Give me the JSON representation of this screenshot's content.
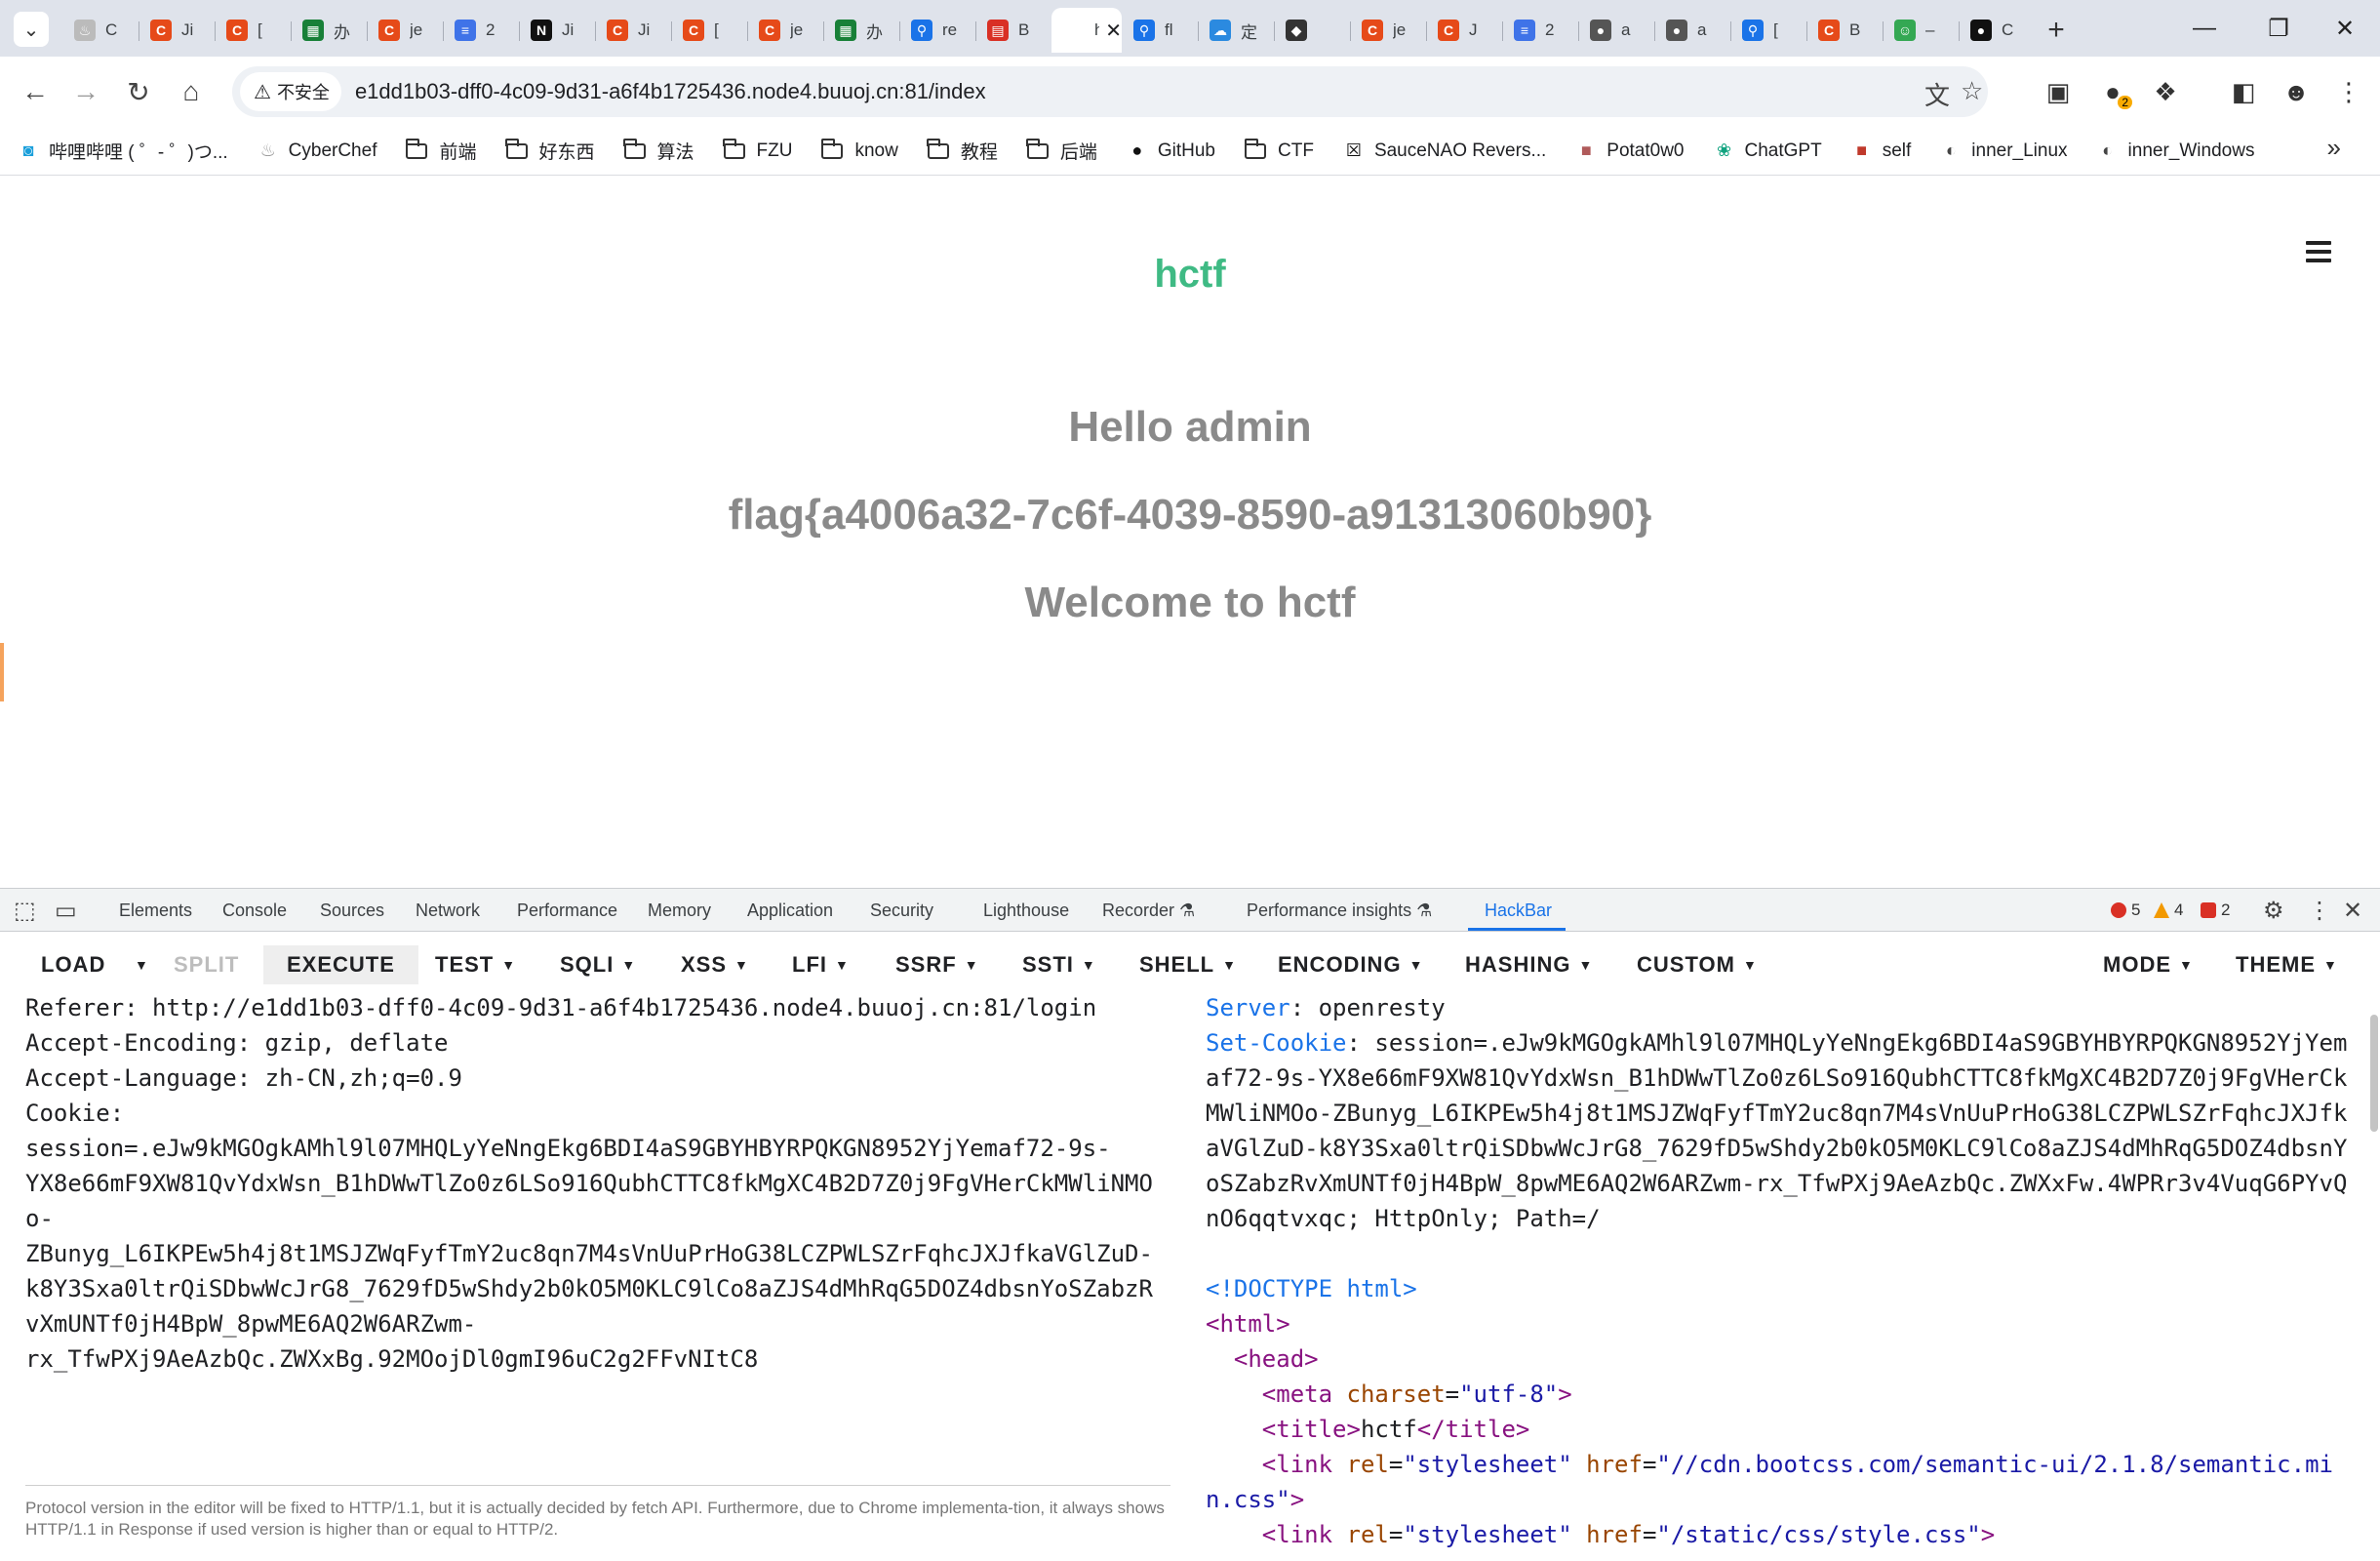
{
  "browser": {
    "tabs": [
      {
        "icon": "chef-icon",
        "title": "C",
        "color": "#bbbbbb",
        "glyph": "♨"
      },
      {
        "icon": "csdn-icon",
        "title": "Ji",
        "color": "#e64a19",
        "glyph": "C"
      },
      {
        "icon": "csdn-icon",
        "title": "[",
        "color": "#e64a19",
        "glyph": "C"
      },
      {
        "icon": "sheets-icon",
        "title": "办",
        "color": "#188038",
        "glyph": "▦"
      },
      {
        "icon": "csdn-icon",
        "title": "je",
        "color": "#e64a19",
        "glyph": "C"
      },
      {
        "icon": "docs-icon",
        "title": "2",
        "color": "#3f73e8",
        "glyph": "≡"
      },
      {
        "icon": "notion-icon",
        "title": "Ji",
        "color": "#111111",
        "glyph": "N"
      },
      {
        "icon": "csdn-icon",
        "title": "Ji",
        "color": "#e64a19",
        "glyph": "C"
      },
      {
        "icon": "csdn-icon",
        "title": "[",
        "color": "#e64a19",
        "glyph": "C"
      },
      {
        "icon": "csdn-icon",
        "title": "je",
        "color": "#e64a19",
        "glyph": "C"
      },
      {
        "icon": "sheets-icon",
        "title": "办",
        "color": "#188038",
        "glyph": "▦"
      },
      {
        "icon": "search-icon",
        "title": "re",
        "color": "#1a73e8",
        "glyph": "⚲"
      },
      {
        "icon": "pdf-icon",
        "title": "B",
        "color": "#d93025",
        "glyph": "▤"
      },
      {
        "icon": "page-icon",
        "title": "h",
        "color": "#ffffff",
        "glyph": "",
        "active": true,
        "close": "✕"
      },
      {
        "icon": "search-icon",
        "title": "fl",
        "color": "#1a73e8",
        "glyph": "⚲"
      },
      {
        "icon": "cloud-icon",
        "title": "定",
        "color": "#2b8ae0",
        "glyph": "☁"
      },
      {
        "icon": "cat-icon",
        "title": "",
        "color": "#333333",
        "glyph": "◆"
      },
      {
        "icon": "csdn-icon",
        "title": "je",
        "color": "#e64a19",
        "glyph": "C"
      },
      {
        "icon": "csdn-icon",
        "title": "J",
        "color": "#e64a19",
        "glyph": "C"
      },
      {
        "icon": "docs-icon",
        "title": "2",
        "color": "#3f73e8",
        "glyph": "≡"
      },
      {
        "icon": "globe-icon",
        "title": "a",
        "color": "#555555",
        "glyph": "●"
      },
      {
        "icon": "globe-icon",
        "title": "a",
        "color": "#555555",
        "glyph": "●"
      },
      {
        "icon": "search-icon",
        "title": "[",
        "color": "#1a73e8",
        "glyph": "⚲"
      },
      {
        "icon": "csdn-icon",
        "title": "B",
        "color": "#e64a19",
        "glyph": "C"
      },
      {
        "icon": "chat-icon",
        "title": "–",
        "color": "#34a853",
        "glyph": "☺"
      },
      {
        "icon": "github-icon",
        "title": "C",
        "color": "#111111",
        "glyph": "●"
      }
    ],
    "new_tab": "+",
    "menu_glyph": "⌄",
    "window_controls": {
      "minimize": "—",
      "restore": "❐",
      "close": "✕"
    },
    "nav": {
      "back": "←",
      "forward": "→",
      "reload": "↻",
      "home": "⌂"
    },
    "security_label": "不安全",
    "security_glyph": "⚠",
    "url": "e1dd1b03-dff0-4c09-9d31-a6f4b1725436.node4.buuoj.cn:81/index",
    "omnibox_icons": {
      "translate": "文",
      "star": "☆"
    },
    "toolbar_icons": {
      "extension_1": "▣",
      "extension_2": "●",
      "extension_badge": "2",
      "extensions": "❖",
      "sidepanel": "◧",
      "profile": "☻",
      "menu": "⋮"
    },
    "bookmarks": [
      {
        "label": "哔哩哔哩 ( ゜- ゜)つ...",
        "icon": "bilibili-icon",
        "glyph": "◙",
        "color": "#1a9fdb"
      },
      {
        "label": "CyberChef",
        "icon": "chef-icon",
        "glyph": "♨",
        "color": "#999999"
      },
      {
        "label": "前端",
        "icon": "folder-icon",
        "folder": true
      },
      {
        "label": "好东西",
        "icon": "folder-icon",
        "folder": true
      },
      {
        "label": "算法",
        "icon": "folder-icon",
        "folder": true
      },
      {
        "label": "FZU",
        "icon": "folder-icon",
        "folder": true
      },
      {
        "label": "know",
        "icon": "folder-icon",
        "folder": true
      },
      {
        "label": "教程",
        "icon": "folder-icon",
        "folder": true
      },
      {
        "label": "后端",
        "icon": "folder-icon",
        "folder": true
      },
      {
        "label": "GitHub",
        "icon": "github-icon",
        "glyph": "●",
        "color": "#111111"
      },
      {
        "label": "CTF",
        "icon": "folder-icon",
        "folder": true
      },
      {
        "label": "SauceNAO Revers...",
        "icon": "saucenao-icon",
        "glyph": "☒",
        "color": "#111111"
      },
      {
        "label": "Potat0w0",
        "icon": "avatar-icon",
        "glyph": "■",
        "color": "#b05a5a"
      },
      {
        "label": "ChatGPT",
        "icon": "chatgpt-icon",
        "glyph": "❀",
        "color": "#10a37f"
      },
      {
        "label": "self",
        "icon": "avatar-icon",
        "glyph": "■",
        "color": "#c0392b"
      },
      {
        "label": "inner_Linux",
        "icon": "globe-icon",
        "glyph": "◐",
        "color": "#444444"
      },
      {
        "label": "inner_Windows",
        "icon": "globe-icon",
        "glyph": "◐",
        "color": "#444444"
      }
    ],
    "bookmarks_more": "»"
  },
  "page": {
    "site_title": "hctf",
    "greeting": "Hello admin",
    "flag": "flag{a4006a32-7c6f-4039-8590-a91313060b90}",
    "welcome": "Welcome to hctf",
    "accent": "#3fba84"
  },
  "devtools": {
    "tabs": [
      "Elements",
      "Console",
      "Sources",
      "Network",
      "Performance",
      "Memory",
      "Application",
      "Security",
      "Lighthouse",
      "Recorder ⚗",
      "Performance insights ⚗",
      "HackBar"
    ],
    "active_tab": "HackBar",
    "errors": "5",
    "warnings": "4",
    "issues": "2",
    "icons": {
      "inspect": "⬚",
      "device": "▭",
      "settings": "⚙",
      "more": "⋮",
      "close": "✕"
    },
    "hackbar": {
      "load": "LOAD",
      "split": "SPLIT",
      "execute": "EXECUTE",
      "menus": [
        "TEST",
        "SQLI",
        "XSS",
        "LFI",
        "SSRF",
        "SSTI",
        "SHELL",
        "ENCODING",
        "HASHING",
        "CUSTOM"
      ],
      "mode": "MODE",
      "theme": "THEME",
      "caret": "▼",
      "request_lines": [
        "Referer: http://e1dd1b03-dff0-4c09-9d31-a6f4b1725436.node4.buuoj.cn:81/login",
        "Accept-Encoding: gzip, deflate",
        "Accept-Language: zh-CN,zh;q=0.9",
        "Cookie:",
        "session=.eJw9kMGOgkAMhl9l07MHQLyYeNngEkg6BDI4aS9GBYHBYRPQKGN8952YjYemaf72-9s-",
        "YX8e66mF9XW81QvYdxWsn_B1hDWwTlZo0z6LSo916QubhCTTC8fkMgXC4B2D7Z0j9FgVHerCkMWliNMO",
        "o-",
        "ZBunyg_L6IKPEw5h4j8t1MSJZWqFyfTmY2uc8qn7M4sVnUuPrHoG38LCZPWLSZrFqhcJXJfkaVGlZuD-",
        "k8Y3Sxa0ltrQiSDbwWcJrG8_7629fD5wShdy2b0kO5M0KLC9lCo8aZJS4dMhRqG5DOZ4dbsnYoSZabzR",
        "vXmUNTf0jH4BpW_8pwME6AQ2W6ARZwm-",
        "rx_TfwPXj9AeAzbQc.ZWXxBg.92MOojDl0gmI96uC2g2FFvNItC8"
      ],
      "note": "Protocol version in the editor will be fixed to HTTP/1.1, but it is actually decided by fetch API. Furthermore, due to Chrome implementa-tion, it always shows HTTP/1.1 in Response if used version is higher than or equal to HTTP/2.",
      "response": {
        "server_key": "Server",
        "server_val": ": openresty",
        "cookie_key": "Set-Cookie",
        "cookie_val": ": session=.eJw9kMGOgkAMhl9l07MHQLyYeNngEkg6BDI4aS9GBYHBYRPQKGN8952YjYemaf72-9s-YX8e66mF9XW81QvYdxWsn_B1hDWwTlZo0z6LSo916QubhCTTC8fkMgXC4B2D7Z0j9FgVHerCkMWliNMOo-ZBunyg_L6IKPEw5h4j8t1MSJZWqFyfTmY2uc8qn7M4sVnUuPrHoG38LCZPWLSZrFqhcJXJfkaVGlZuD-k8Y3Sxa0ltrQiSDbwWcJrG8_7629fD5wShdy2b0kO5M0KLC9lCo8aZJS4dMhRqG5DOZ4dbsnYoSZabzRvXmUNTf0jH4BpW_8pwME6AQ2W6ARZwm-rx_TfwPXj9AeAzbQc.ZWXxFw.4WPRr3v4VuqG6PYvQnO6qqtvxqc; HttpOnly; Path=/",
        "doctype": "<!DOCTYPE html>",
        "html_open": "<html>",
        "head_open": "<head>",
        "meta": {
          "tag": "meta",
          "attr": "charset",
          "val": "\"utf-8\""
        },
        "title": {
          "open": "<title>",
          "text": "hctf",
          "close": "</title>"
        },
        "link1": {
          "tag": "link",
          "attr1": "rel",
          "val1": "\"stylesheet\"",
          "attr2": "href",
          "val2": "\"//cdn.bootcss.com/semantic-ui/2.1.8/semantic.min.css\""
        },
        "link2": {
          "tag": "link",
          "attr1": "rel",
          "val1": "\"stylesheet\"",
          "attr2": "href",
          "val2": "\"/static/css/style.css\""
        }
      }
    }
  }
}
